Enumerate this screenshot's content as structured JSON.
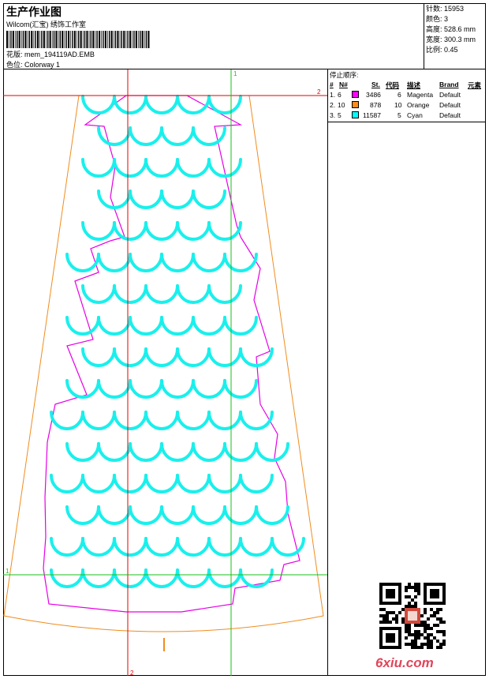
{
  "header": {
    "title": "生产作业图",
    "company": "Wilcom(汇宝) 绣饰工作室",
    "design_file_label": "花版:",
    "design_file": "mem_194119AD.EMB",
    "colorway_label": "色位:",
    "colorway": "Colorway 1"
  },
  "stats": {
    "stitches_label": "针数:",
    "stitches": "15953",
    "colors_label": "颜色:",
    "colors": "3",
    "height_label": "高度:",
    "height": "528.6 mm",
    "width_label": "宽度:",
    "width": "300.3 mm",
    "scale_label": "比例:",
    "scale": "0.45"
  },
  "stop_sequence": {
    "caption": "停止顺序:",
    "headers": {
      "num": "#",
      "needle": "N#",
      "stitches": "St.",
      "code": "代码",
      "desc": "描述",
      "brand": "Brand",
      "element": "元素"
    },
    "rows": [
      {
        "num": "1.",
        "needle": "6",
        "color": "#ff00ff",
        "stitches": "3486",
        "code": "6",
        "desc": "Magenta",
        "brand": "Default"
      },
      {
        "num": "2.",
        "needle": "10",
        "color": "#ff8c1a",
        "stitches": "878",
        "code": "10",
        "desc": "Orange",
        "brand": "Default"
      },
      {
        "num": "3.",
        "needle": "5",
        "color": "#00ffff",
        "stitches": "11587",
        "code": "5",
        "desc": "Cyan",
        "brand": "Default"
      }
    ]
  },
  "guides": {
    "v1": "1",
    "v2": "2",
    "h1": "1",
    "h2": "2"
  },
  "colors": {
    "cyan": "#19f0ec",
    "magenta": "#e600e6",
    "orange": "#f08c1e",
    "red": "#e60000",
    "green": "#18c018"
  },
  "watermark": "6xiu.com"
}
